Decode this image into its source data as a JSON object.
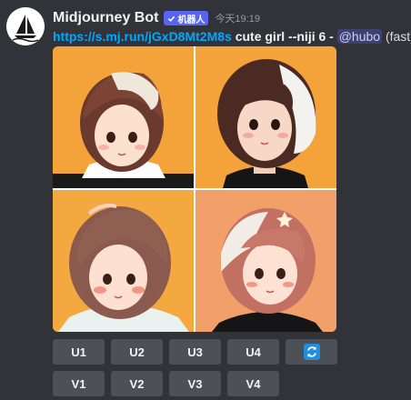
{
  "message": {
    "username": "Midjourney Bot",
    "bot_badge": "机器人",
    "timestamp": "今天19:19",
    "link_text": "https://s.mj.run/jGxD8Mt2M8s",
    "prompt_text": " cute girl --niji 6 - ",
    "mention": "@hubo",
    "speed": " (fast)"
  },
  "buttons": {
    "upscale": [
      "U1",
      "U2",
      "U3",
      "U4"
    ],
    "variation": [
      "V1",
      "V2",
      "V3",
      "V4"
    ],
    "reroll_icon": "refresh-icon"
  },
  "colors": {
    "accent": "#5865f2",
    "link": "#00a8fc",
    "reroll": "#1e8fe1",
    "button_bg": "#4e5058",
    "background": "#313338"
  },
  "images": [
    {
      "subject": "girl-light-bangs-orange-bg"
    },
    {
      "subject": "girl-dark-white-hair-orange-bg"
    },
    {
      "subject": "girl-brown-bob-orange-bg"
    },
    {
      "subject": "girl-pink-bob-orange-bg"
    }
  ]
}
